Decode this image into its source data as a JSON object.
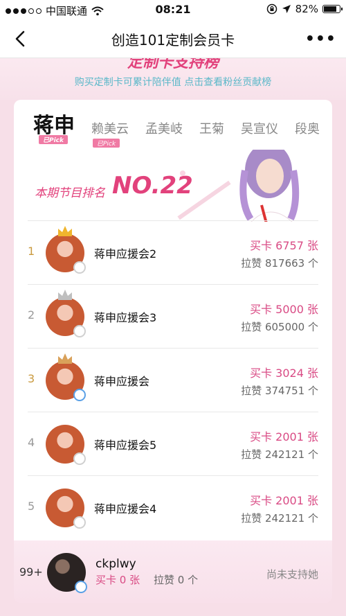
{
  "status_bar": {
    "carrier": "中国联通",
    "time": "08:21",
    "battery": "82%",
    "battery_level": 0.82,
    "signal_bars": 3
  },
  "nav": {
    "title": "创造101定制会员卡",
    "more": "•••"
  },
  "banner": {
    "heading": "定制卡支持榜",
    "subtitle": "购买定制卡可累计陪伴值 点击查看粉丝贡献榜"
  },
  "tabs": [
    {
      "label": "蒋申",
      "pick": "已Pick",
      "active": true
    },
    {
      "label": "赖美云",
      "pick": "已Pick",
      "active": false
    },
    {
      "label": "孟美岐",
      "pick": "",
      "active": false
    },
    {
      "label": "王菊",
      "pick": "",
      "active": false
    },
    {
      "label": "吴宣仪",
      "pick": "",
      "active": false
    },
    {
      "label": "段奥",
      "pick": "",
      "active": false
    }
  ],
  "rank": {
    "label": "本期节目排名",
    "value": "NO.22"
  },
  "list": [
    {
      "num": "1",
      "name": "蒋申应援会2",
      "cards": "买卡 6757 张",
      "likes": "拉赞 817663 个",
      "crown": "gold",
      "medal": "grey"
    },
    {
      "num": "2",
      "name": "蒋申应援会3",
      "cards": "买卡 5000 张",
      "likes": "拉赞 605000 个",
      "crown": "silver",
      "medal": "grey"
    },
    {
      "num": "3",
      "name": "蒋申应援会",
      "cards": "买卡 3024 张",
      "likes": "拉赞 374751 个",
      "crown": "bronze",
      "medal": "blue"
    },
    {
      "num": "4",
      "name": "蒋申应援会5",
      "cards": "买卡 2001 张",
      "likes": "拉赞 242121 个",
      "crown": "",
      "medal": "grey"
    },
    {
      "num": "5",
      "name": "蒋申应援会4",
      "cards": "买卡 2001 张",
      "likes": "拉赞 242121 个",
      "crown": "",
      "medal": "grey"
    }
  ],
  "me": {
    "rank": "99+",
    "name": "ckplwy",
    "cards": "买卡 0 张",
    "likes": "拉赞 0 个",
    "status": "尚未支持她"
  },
  "colors": {
    "accent": "#d94a84",
    "gold": "#c99a3f",
    "subtitle": "#5bb8c9",
    "background": "#f7dfe8"
  }
}
